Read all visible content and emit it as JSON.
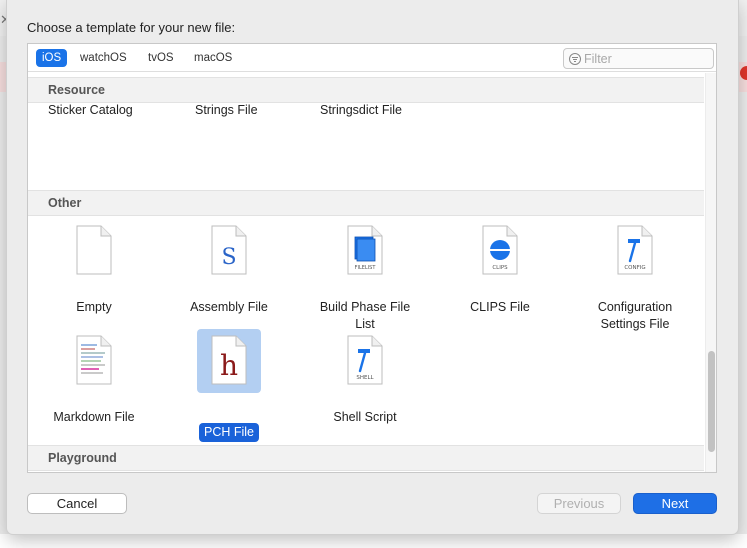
{
  "sheet": {
    "title": "Choose a template for your new file:"
  },
  "tabs": [
    {
      "label": "iOS",
      "selected": true
    },
    {
      "label": "watchOS",
      "selected": false
    },
    {
      "label": "tvOS",
      "selected": false
    },
    {
      "label": "macOS",
      "selected": false
    }
  ],
  "filter": {
    "placeholder": "Filter",
    "value": ""
  },
  "sections": {
    "resource": {
      "title": "Resource",
      "items": [
        "Sticker Catalog",
        "Strings File",
        "Stringsdict File"
      ]
    },
    "other": {
      "title": "Other",
      "items": [
        {
          "label": "Empty",
          "icon": "blank-document-icon"
        },
        {
          "label": "Assembly File",
          "icon": "assembly-s-icon",
          "glyph": "S"
        },
        {
          "label": "Build Phase File\nList",
          "icon": "filelist-icon",
          "badge": "FILELIST"
        },
        {
          "label": "CLIPS File",
          "icon": "clips-icon",
          "badge": "CLIPS"
        },
        {
          "label": "Configuration\nSettings File",
          "icon": "config-hammer-icon",
          "badge": "CONFIG"
        },
        {
          "label": "Markdown File",
          "icon": "markdown-document-icon"
        },
        {
          "label": "PCH File",
          "icon": "pch-h-icon",
          "glyph": "h",
          "selected": true
        },
        {
          "label": "Shell Script",
          "icon": "shell-hammer-icon",
          "badge": "SHELL"
        }
      ]
    },
    "playground": {
      "title": "Playground",
      "items": [
        {
          "icon": "swift-playground-icon"
        },
        {
          "icon": "swift-playground-icon"
        },
        {
          "icon": "swift-playground-icon"
        },
        {
          "icon": "swift-playground-icon"
        }
      ]
    }
  },
  "buttons": {
    "cancel": "Cancel",
    "previous": "Previous",
    "next": "Next"
  },
  "colors": {
    "accent": "#1e6fe6",
    "selection_bg": "#b3cff2",
    "pch_red": "#8b1a1a",
    "swift_blue": "#3e78d6"
  }
}
